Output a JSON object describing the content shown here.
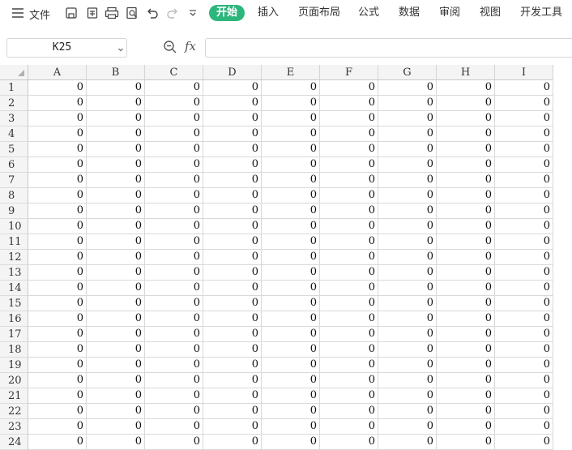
{
  "toolbar": {
    "menu_label": "文件",
    "tabs": [
      "开始",
      "插入",
      "页面布局",
      "公式",
      "数据",
      "审阅",
      "视图",
      "开发工具"
    ],
    "active_tab": "开始",
    "accent_color": "#2db67c",
    "icons": [
      "hamburger-icon",
      "save-icon",
      "export-pdf-icon",
      "print-icon",
      "print-preview-icon",
      "undo-icon",
      "redo-icon",
      "more-dropdown-icon"
    ]
  },
  "formula_bar": {
    "name_box": "K25",
    "fx_label": "fx",
    "formula_value": ""
  },
  "sheet": {
    "columns": [
      "A",
      "B",
      "C",
      "D",
      "E",
      "F",
      "G",
      "H",
      "I"
    ],
    "rows": [
      "1",
      "2",
      "3",
      "4",
      "5",
      "6",
      "7",
      "8",
      "9",
      "10",
      "11",
      "12",
      "13",
      "14",
      "15",
      "16",
      "17",
      "18",
      "19",
      "20",
      "21",
      "22",
      "23",
      "24"
    ],
    "cell_value": "0"
  }
}
